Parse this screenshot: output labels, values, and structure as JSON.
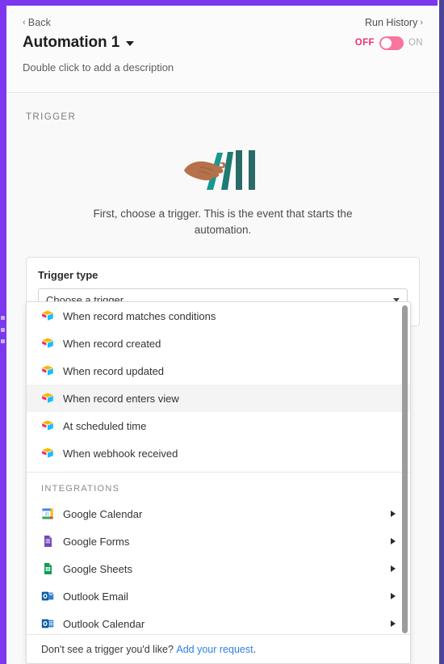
{
  "theme": {
    "accent_purple": "#7c37ef",
    "edge_right": "#4a4599",
    "toggle_off_pink": "#f0316a",
    "link_blue": "#2e7fe8",
    "highlight_gray": "#f4f4f4"
  },
  "header": {
    "back_label": "Back",
    "back_chevron": "‹",
    "run_history_label": "Run History",
    "run_history_chevron": "›",
    "title": "Automation 1",
    "caret_icon": "chevron-down-icon",
    "toggle": {
      "off_label": "OFF",
      "on_label": "ON",
      "state": "OFF"
    },
    "description_placeholder": "Double click to add a description"
  },
  "trigger_section": {
    "section_label": "TRIGGER",
    "illustration": "hand-pushing-dominoes-illustration",
    "hint_text": "First, choose a trigger. This is the event that starts the automation.",
    "field_label": "Trigger type",
    "select_value": "Choose a trigger",
    "select_caret": "chevron-down-icon"
  },
  "dropdown": {
    "triggers": [
      {
        "label": "When record matches conditions",
        "icon": "airtable-cube-icon",
        "highlighted": false
      },
      {
        "label": "When record created",
        "icon": "airtable-cube-icon",
        "highlighted": false
      },
      {
        "label": "When record updated",
        "icon": "airtable-cube-icon",
        "highlighted": false
      },
      {
        "label": "When record enters view",
        "icon": "airtable-cube-icon",
        "highlighted": true
      },
      {
        "label": "At scheduled time",
        "icon": "airtable-cube-icon",
        "highlighted": false
      },
      {
        "label": "When webhook received",
        "icon": "airtable-cube-icon",
        "highlighted": false
      }
    ],
    "integrations_label": "INTEGRATIONS",
    "integrations": [
      {
        "label": "Google Calendar",
        "icon": "google-calendar-icon",
        "has_submenu": true
      },
      {
        "label": "Google Forms",
        "icon": "google-forms-icon",
        "has_submenu": true
      },
      {
        "label": "Google Sheets",
        "icon": "google-sheets-icon",
        "has_submenu": true
      },
      {
        "label": "Outlook Email",
        "icon": "outlook-email-icon",
        "has_submenu": true
      },
      {
        "label": "Outlook Calendar",
        "icon": "outlook-calendar-icon",
        "has_submenu": true
      }
    ],
    "footer": {
      "text": "Don't see a trigger you'd like?",
      "link_text": "Add your request",
      "trailing": "."
    }
  }
}
